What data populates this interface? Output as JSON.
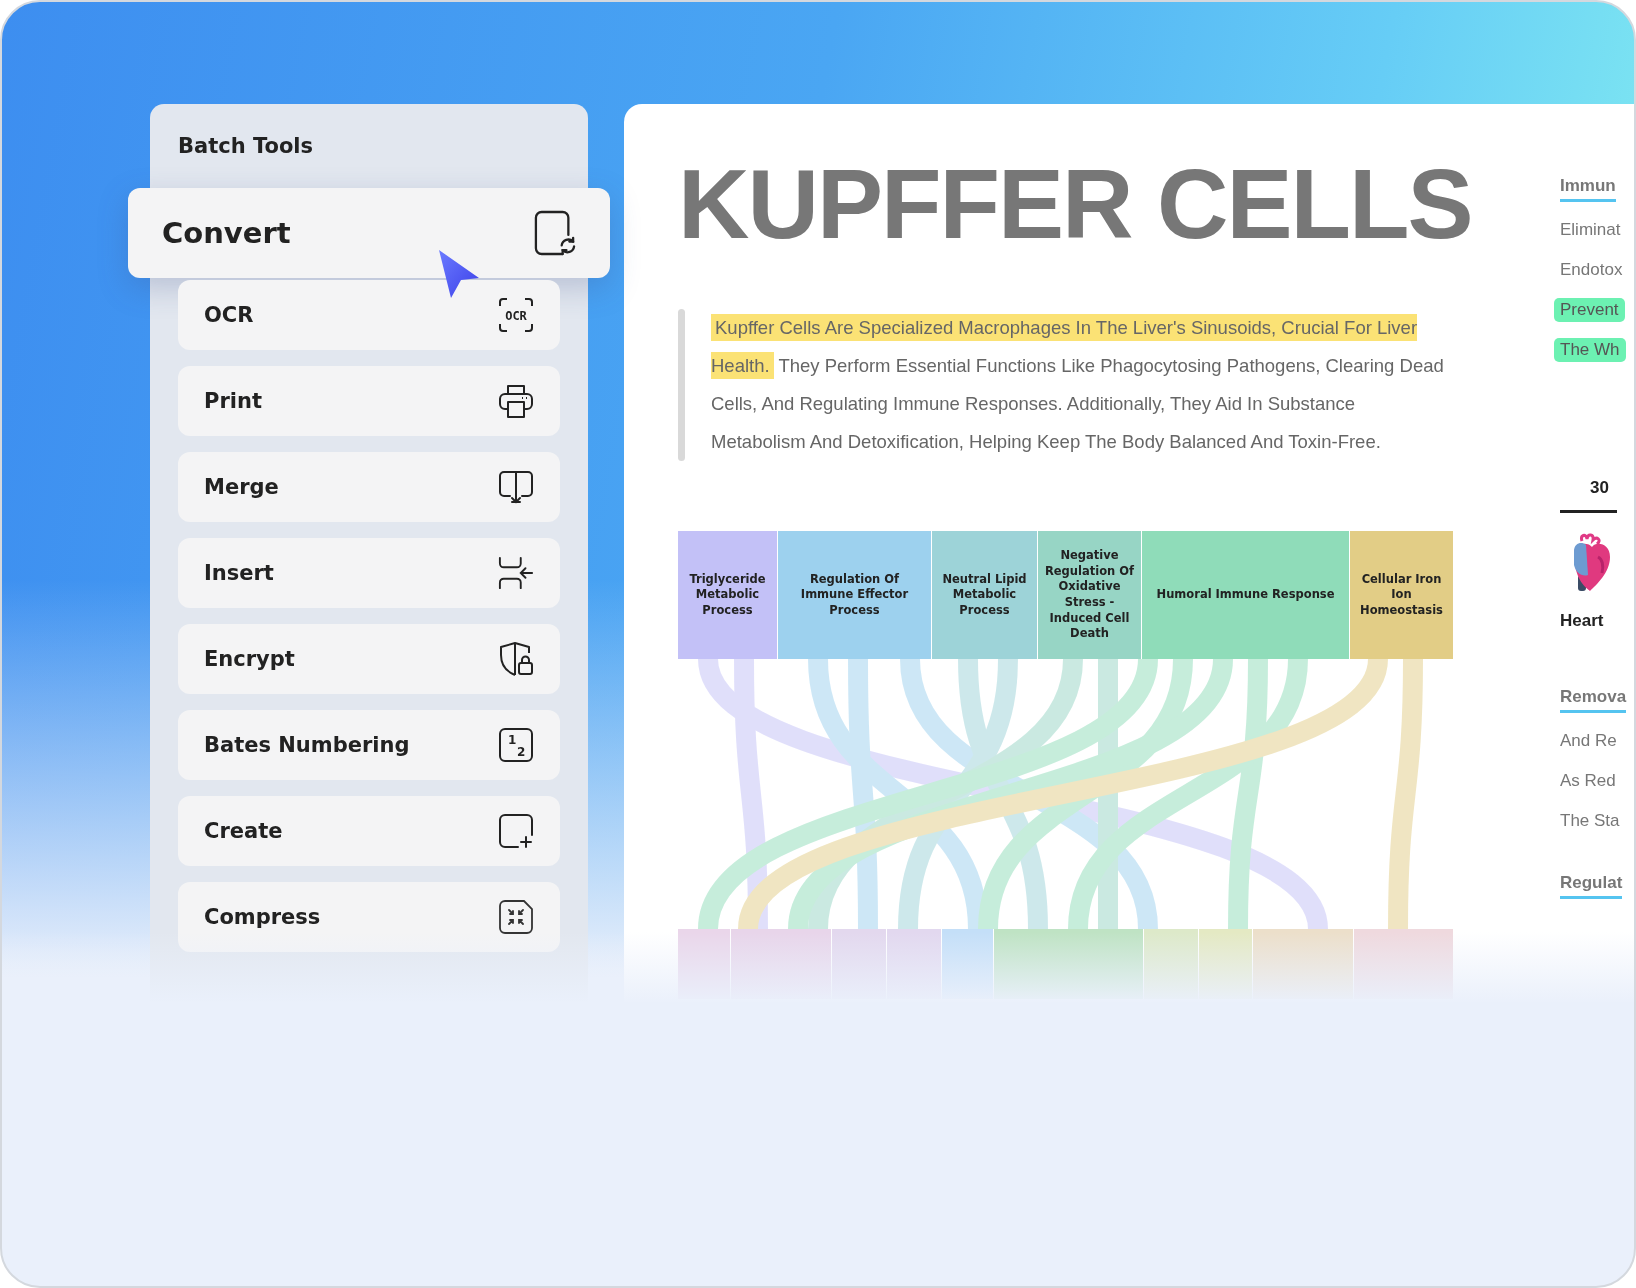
{
  "sidebar": {
    "title": "Batch Tools",
    "items": [
      {
        "label": "Convert",
        "kind": "convert",
        "selected": true
      },
      {
        "label": "OCR",
        "kind": "ocr",
        "icon_text": [
          "OCR"
        ],
        "selected": false
      },
      {
        "label": "Print",
        "kind": "print",
        "selected": false
      },
      {
        "label": "Merge",
        "kind": "merge",
        "selected": false
      },
      {
        "label": "Insert",
        "kind": "insert",
        "selected": false
      },
      {
        "label": "Encrypt",
        "kind": "encrypt",
        "selected": false
      },
      {
        "label": "Bates Numbering",
        "kind": "bates",
        "icon_text": [
          "1",
          "2"
        ],
        "selected": false
      },
      {
        "label": "Create",
        "kind": "create",
        "selected": false
      },
      {
        "label": "Compress",
        "kind": "compress",
        "selected": false
      }
    ]
  },
  "document": {
    "title": "KUPFFER CELLS",
    "intro": {
      "highlight": "Kupffer Cells Are Specialized Macrophages In The Liver's Sinusoids, Crucial For Liver Health.",
      "text": "They Perform Essential Functions Like Phagocytosing Pathogens, Clearing Dead Cells, And Regulating Immune Responses. Additionally, They Aid In Substance Metabolism And Detoxification, Helping Keep The Body Balanced And Toxin-Free."
    },
    "chart": {
      "categories": [
        {
          "label": "Triglyceride Metabolic Process",
          "color": "#c3c1f7"
        },
        {
          "label": "Regulation Of Immune Effector Process",
          "color": "#9dd1ee"
        },
        {
          "label": "Neutral Lipid Metabolic Process",
          "color": "#9dd3d8"
        },
        {
          "label": "Negative Regulation Of Oxidative Stress - Induced Cell Death",
          "color": "#97d5c5"
        },
        {
          "label": "Humoral Immune Response",
          "color": "#8fdcb9"
        },
        {
          "label": "Cellular Iron Ion Homeostasis",
          "color": "#e2cd86"
        }
      ],
      "targets": [
        {
          "color": "#ead6ea"
        },
        {
          "color": "#e8d5ea"
        },
        {
          "color": "#e3d8ee"
        },
        {
          "color": "#e2d8ef"
        },
        {
          "color": "#c4dff8"
        },
        {
          "color": "#bfe3c4"
        },
        {
          "color": "#dde9c9"
        },
        {
          "color": "#e4e9c3"
        },
        {
          "color": "#ecdfca"
        },
        {
          "color": "#efd9de"
        }
      ]
    }
  },
  "side_column": [
    {
      "kind": "heading",
      "text": "Immun"
    },
    {
      "kind": "line",
      "text": "Eliminat",
      "highlighted": false
    },
    {
      "kind": "line",
      "text": "Endotox",
      "highlighted": false
    },
    {
      "kind": "line",
      "text": "Prevent",
      "highlighted": true
    },
    {
      "kind": "line",
      "text": "The Wh",
      "highlighted": true
    },
    {
      "kind": "stat",
      "text": "30"
    },
    {
      "kind": "organ",
      "text": "Heart"
    },
    {
      "kind": "heading",
      "text": "Remova"
    },
    {
      "kind": "line",
      "text": "And Re",
      "highlighted": false
    },
    {
      "kind": "line",
      "text": "As Red",
      "highlighted": false
    },
    {
      "kind": "line",
      "text": "The Sta",
      "highlighted": false
    },
    {
      "kind": "heading",
      "text": "Regulat"
    }
  ]
}
